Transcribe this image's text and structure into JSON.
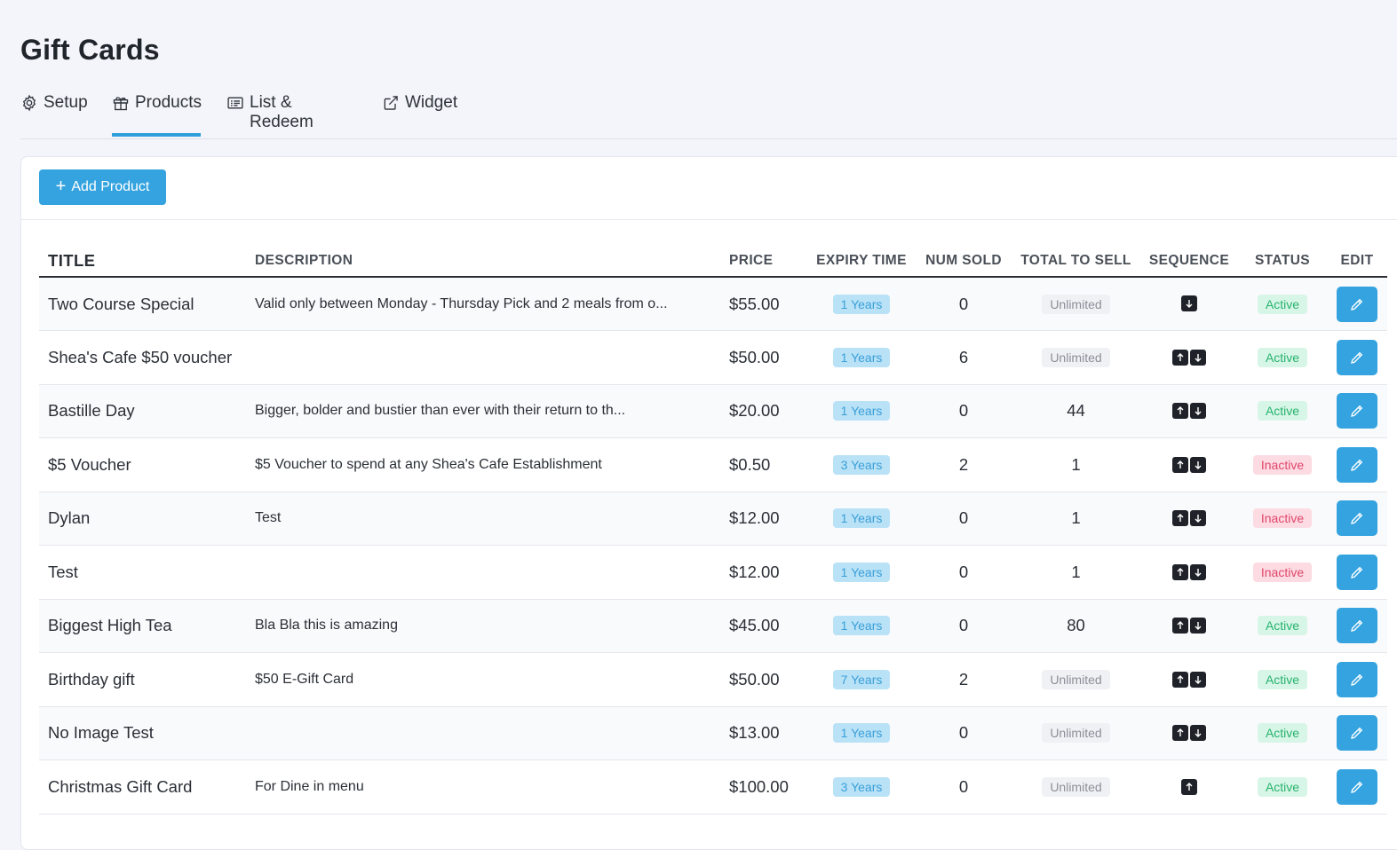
{
  "page": {
    "title": "Gift Cards"
  },
  "tabs": [
    {
      "label": "Setup",
      "icon": "gear-icon",
      "active": false
    },
    {
      "label": "Products",
      "icon": "gift-icon",
      "active": true
    },
    {
      "label": "List & Redeem",
      "icon": "list-card-icon",
      "active": false
    },
    {
      "label": "Widget",
      "icon": "external-link-icon",
      "active": false
    }
  ],
  "toolbar": {
    "add_label": "Add Product"
  },
  "table": {
    "headers": {
      "title": "TITLE",
      "description": "DESCRIPTION",
      "price": "PRICE",
      "expiry": "EXPIRY TIME",
      "sold": "NUM SOLD",
      "total": "TOTAL TO SELL",
      "sequence": "SEQUENCE",
      "status": "STATUS",
      "edit": "EDIT"
    },
    "rows": [
      {
        "title": "Two Course Special",
        "description": "Valid only between Monday - Thursday Pick and 2 meals from o...",
        "price": "$55.00",
        "expiry": "1 Years",
        "sold": "0",
        "total": "Unlimited",
        "total_unlimited": true,
        "up": false,
        "down": true,
        "status": "Active"
      },
      {
        "title": "Shea's Cafe $50 voucher",
        "description": "",
        "price": "$50.00",
        "expiry": "1 Years",
        "sold": "6",
        "total": "Unlimited",
        "total_unlimited": true,
        "up": true,
        "down": true,
        "status": "Active"
      },
      {
        "title": "Bastille Day",
        "description": "Bigger, bolder and bustier than ever with their return to th...",
        "price": "$20.00",
        "expiry": "1 Years",
        "sold": "0",
        "total": "44",
        "total_unlimited": false,
        "up": true,
        "down": true,
        "status": "Active"
      },
      {
        "title": "$5 Voucher",
        "description": "$5 Voucher to spend at any Shea's Cafe Establishment",
        "price": "$0.50",
        "expiry": "3 Years",
        "sold": "2",
        "total": "1",
        "total_unlimited": false,
        "up": true,
        "down": true,
        "status": "Inactive"
      },
      {
        "title": "Dylan",
        "description": "Test",
        "price": "$12.00",
        "expiry": "1 Years",
        "sold": "0",
        "total": "1",
        "total_unlimited": false,
        "up": true,
        "down": true,
        "status": "Inactive"
      },
      {
        "title": "Test",
        "description": "",
        "price": "$12.00",
        "expiry": "1 Years",
        "sold": "0",
        "total": "1",
        "total_unlimited": false,
        "up": true,
        "down": true,
        "status": "Inactive"
      },
      {
        "title": "Biggest High Tea",
        "description": "Bla Bla this is amazing",
        "price": "$45.00",
        "expiry": "1 Years",
        "sold": "0",
        "total": "80",
        "total_unlimited": false,
        "up": true,
        "down": true,
        "status": "Active"
      },
      {
        "title": "Birthday gift",
        "description": "$50 E-Gift Card",
        "price": "$50.00",
        "expiry": "7 Years",
        "sold": "2",
        "total": "Unlimited",
        "total_unlimited": true,
        "up": true,
        "down": true,
        "status": "Active"
      },
      {
        "title": "No Image Test",
        "description": "",
        "price": "$13.00",
        "expiry": "1 Years",
        "sold": "0",
        "total": "Unlimited",
        "total_unlimited": true,
        "up": true,
        "down": true,
        "status": "Active"
      },
      {
        "title": "Christmas Gift Card",
        "description": "For Dine in menu",
        "price": "$100.00",
        "expiry": "3 Years",
        "sold": "0",
        "total": "Unlimited",
        "total_unlimited": true,
        "up": true,
        "down": false,
        "status": "Active"
      }
    ]
  },
  "colors": {
    "accent": "#34a3df",
    "active_text": "#26b26e",
    "inactive_text": "#e0466a",
    "background": "#f3f5fa"
  }
}
